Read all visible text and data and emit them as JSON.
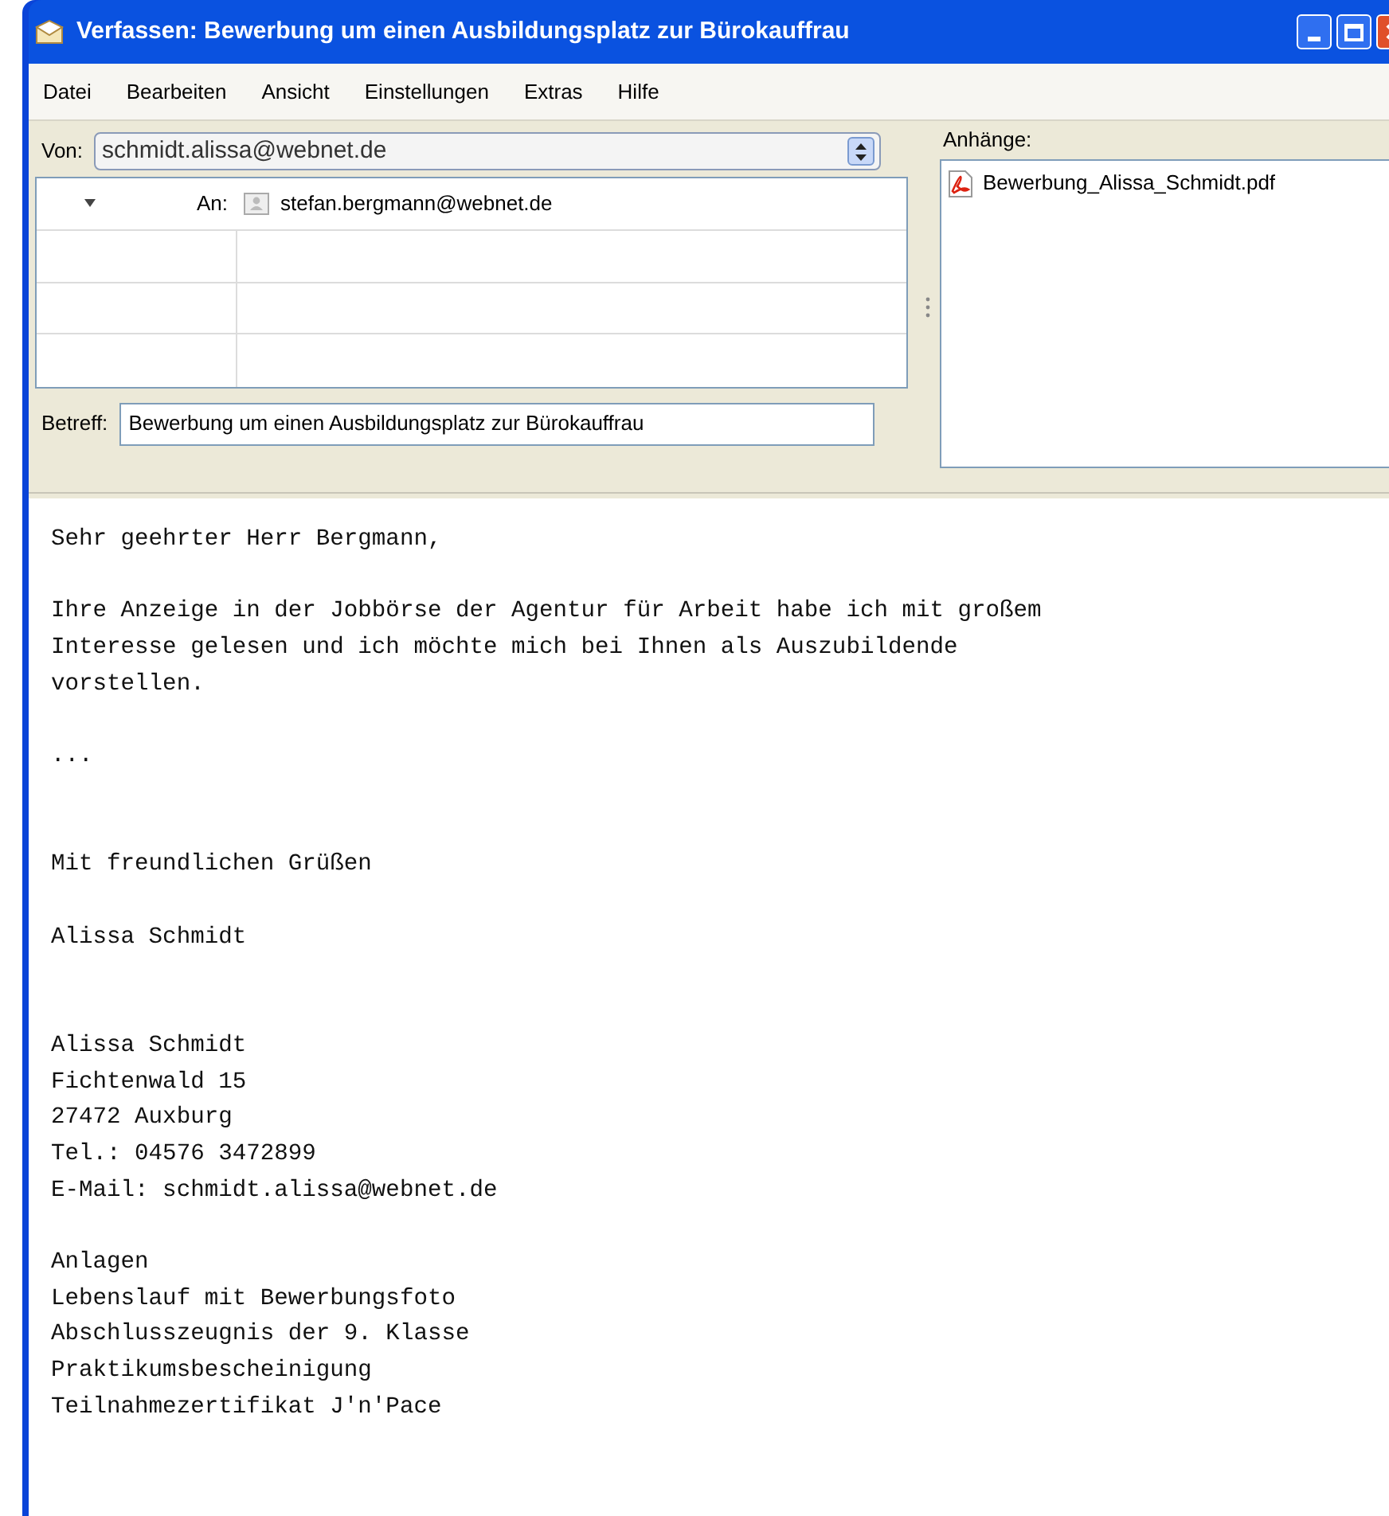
{
  "window": {
    "title": "Verfassen: Bewerbung um einen Ausbildungsplatz zur Bürokauffrau"
  },
  "menu": [
    "Datei",
    "Bearbeiten",
    "Ansicht",
    "Einstellungen",
    "Extras",
    "Hilfe"
  ],
  "from": {
    "label": "Von:",
    "value": "schmidt.alissa@webnet.de"
  },
  "recipients": [
    {
      "type": "An:",
      "address": "stefan.bergmann@webnet.de"
    }
  ],
  "subject": {
    "label": "Betreff:",
    "value": "Bewerbung um einen Ausbildungsplatz zur Bürokauffrau"
  },
  "attachments": {
    "label": "Anhänge:",
    "files": [
      "Bewerbung_Alissa_Schmidt.pdf"
    ]
  },
  "body": "Sehr geehrter Herr Bergmann,\n\nIhre Anzeige in der Jobbörse der Agentur für Arbeit habe ich mit großem\nInteresse gelesen und ich möchte mich bei Ihnen als Auszubildende\nvorstellen.\n\n...\n\n\nMit freundlichen Grüßen\n\nAlissa Schmidt\n\n\nAlissa Schmidt\nFichtenwald 15\n27472 Auxburg\nTel.: 04576 3472899\nE-Mail: schmidt.alissa@webnet.de\n\nAnlagen\nLebenslauf mit Bewerbungsfoto\nAbschlusszeugnis der 9. Klasse\nPraktikumsbescheinigung\nTeilnahmezertifikat J'n'Pace"
}
